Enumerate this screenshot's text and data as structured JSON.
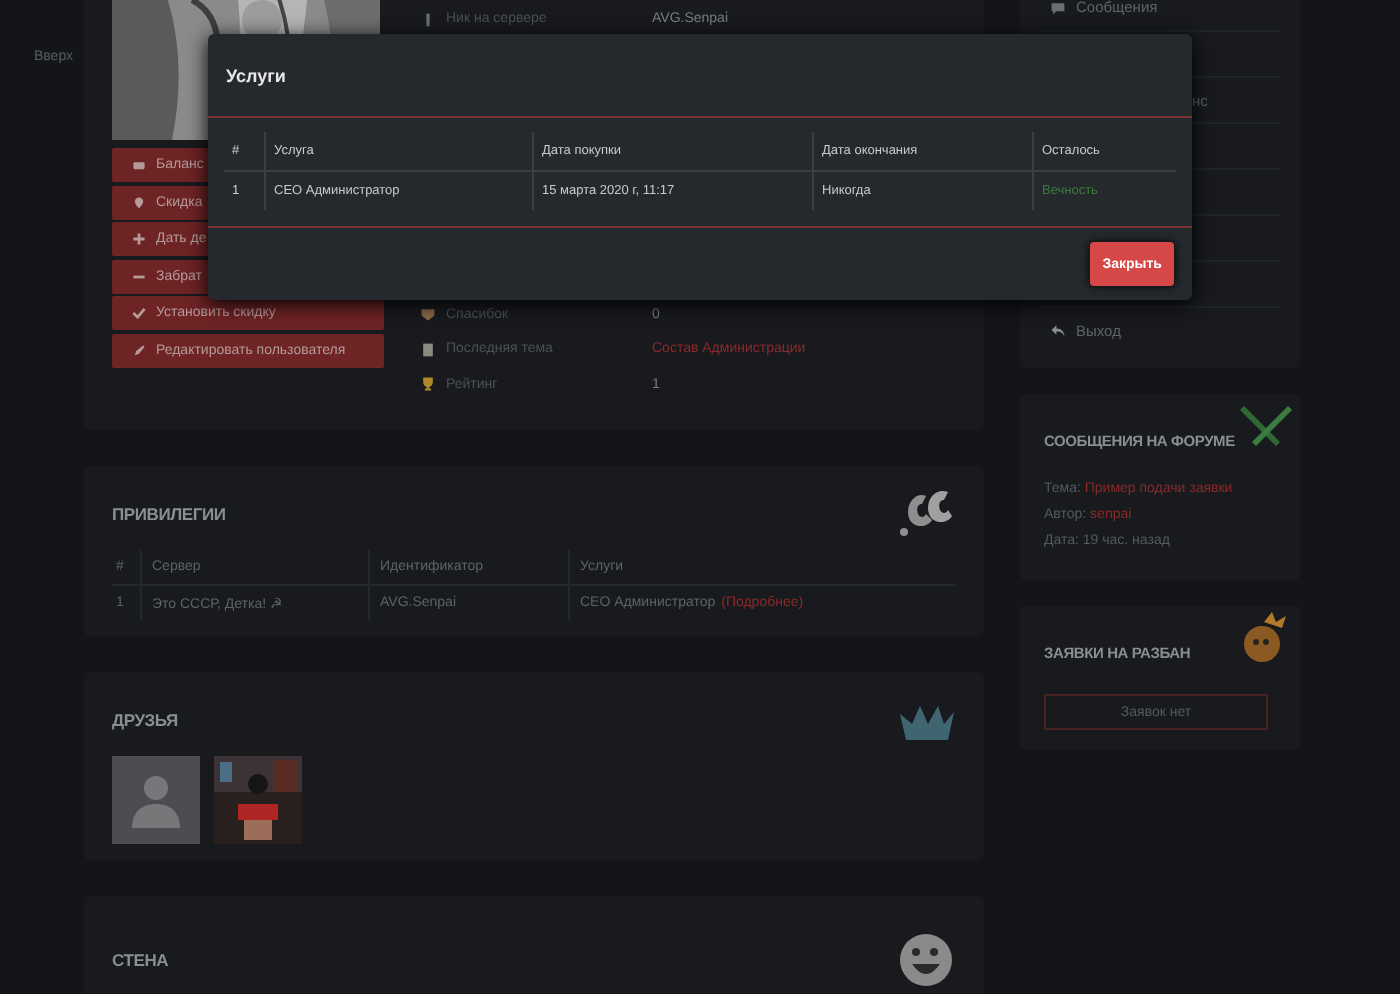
{
  "gutter": {
    "up_link": "Вверх"
  },
  "profile": {
    "action_buttons": [
      {
        "label": "Баланс"
      },
      {
        "label": "Скидка"
      },
      {
        "label": "Дать де"
      },
      {
        "label": "Забрат"
      },
      {
        "label": "Установить скидку"
      },
      {
        "label": "Редактировать пользователя"
      }
    ],
    "info_top": [
      {
        "label": "Ник на сервере",
        "value": "AVG.Senpai"
      }
    ],
    "info_bottom": [
      {
        "label": "Спасибок",
        "value": "0",
        "kind": "text"
      },
      {
        "label": "Последняя тема",
        "value": "Состав Администрации",
        "kind": "link"
      },
      {
        "label": "Рейтинг",
        "value": "1",
        "kind": "text"
      }
    ]
  },
  "privileges": {
    "title": "ПРИВИЛЕГИИ",
    "columns": [
      "#",
      "Сервер",
      "Идентификатор",
      "Услуги"
    ],
    "rows": [
      {
        "number": "1",
        "server": "Это СССР, Детка! ☭",
        "identifier": "AVG.Senpai",
        "service": "CEO Администратор",
        "details_link": "(Подробнее)"
      }
    ]
  },
  "friends": {
    "title": "ДРУЗЬЯ",
    "items": [
      {
        "kind": "default"
      },
      {
        "kind": "picture"
      }
    ]
  },
  "wall": {
    "title": "СТЕНА"
  },
  "sidebar_menu": {
    "items": [
      "Сообщения",
      "нс",
      "Выход"
    ]
  },
  "forum_posts": {
    "title": "СООБЩЕНИЯ НА ФОРУМЕ",
    "topic_label": "Тема:",
    "topic": "Пример подачи заявки",
    "author_label": "Автор:",
    "author": "senpai",
    "date": "Дата: 19 час. назад"
  },
  "unban_requests": {
    "title": "ЗАЯВКИ НА РАЗБАН",
    "empty": "Заявок нет"
  },
  "modal": {
    "title": "Услуги",
    "columns": [
      "#",
      "Услуга",
      "Дата покупки",
      "Дата окончания",
      "Осталось"
    ],
    "rows": [
      {
        "number": "1",
        "service": "CEO Администратор",
        "purchased": "15 марта 2020 г, 11:17",
        "expires": "Никогда",
        "remaining": "Вечность"
      }
    ],
    "close_button": "Закрыть"
  }
}
